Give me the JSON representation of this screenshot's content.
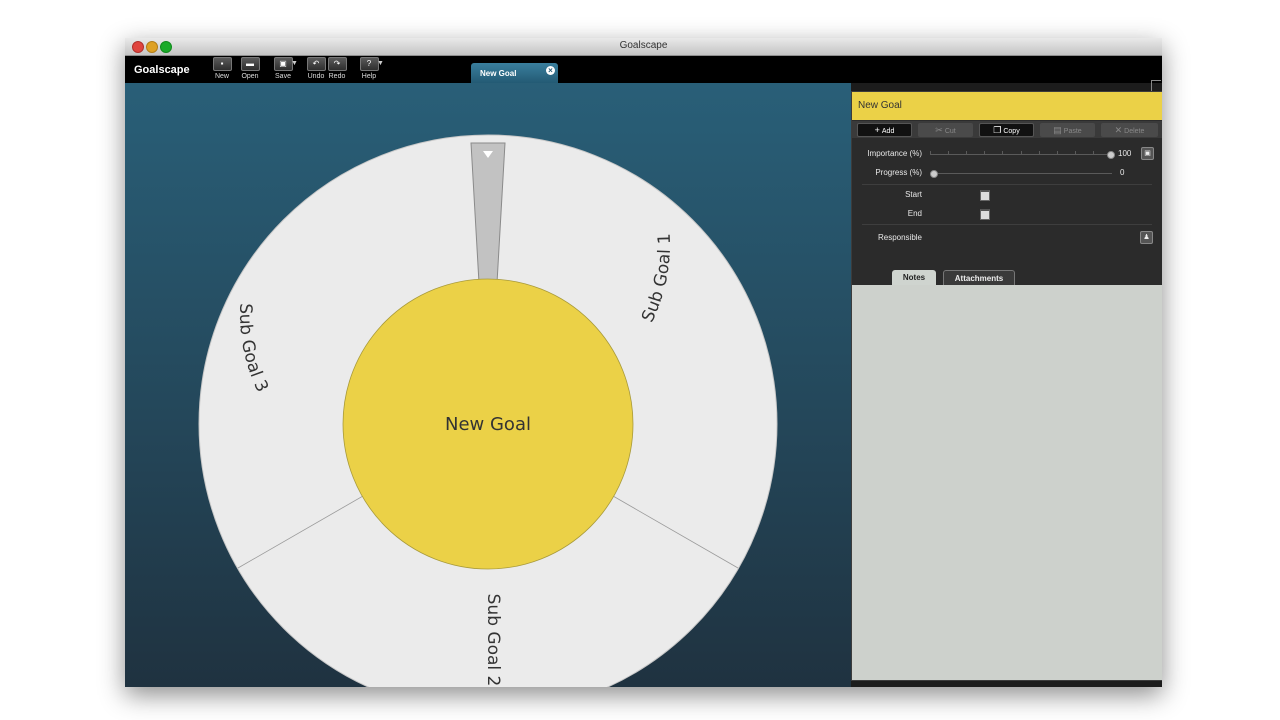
{
  "window": {
    "title": "Goalscape"
  },
  "toolbar": {
    "brand": "Goalscape",
    "buttons": [
      {
        "label": "New",
        "icon": "new-document-icon"
      },
      {
        "label": "Open",
        "icon": "open-folder-icon"
      },
      {
        "label": "Save",
        "icon": "save-icon"
      },
      {
        "label": "Undo",
        "icon": "undo-icon"
      },
      {
        "label": "Redo",
        "icon": "redo-icon"
      },
      {
        "label": "Help",
        "icon": "help-icon"
      }
    ],
    "help_glyph": "?"
  },
  "document_tab": {
    "label": "New Goal"
  },
  "goalscape": {
    "center_label": "New Goal",
    "center_color": "#ebd147",
    "ring_color": "#ebebeb",
    "sub_goals": [
      {
        "label": "Sub Goal 1"
      },
      {
        "label": "Sub Goal 2"
      },
      {
        "label": "Sub Goal 3"
      }
    ]
  },
  "panel": {
    "title": "New Goal",
    "actions": [
      {
        "label": "Add",
        "enabled": true,
        "icon": "plus-icon"
      },
      {
        "label": "Cut",
        "enabled": false,
        "icon": "scissors-icon"
      },
      {
        "label": "Copy",
        "enabled": true,
        "icon": "copy-icon"
      },
      {
        "label": "Paste",
        "enabled": false,
        "icon": "paste-icon"
      },
      {
        "label": "Delete",
        "enabled": false,
        "icon": "delete-x-icon"
      }
    ],
    "importance": {
      "label": "Importance (%)",
      "value": "100"
    },
    "progress": {
      "label": "Progress (%)",
      "value": "0"
    },
    "start_label": "Start",
    "end_label": "End",
    "responsible_label": "Responsible",
    "tabs": [
      {
        "label": "Notes",
        "active": true
      },
      {
        "label": "Attachments",
        "active": false
      }
    ]
  }
}
